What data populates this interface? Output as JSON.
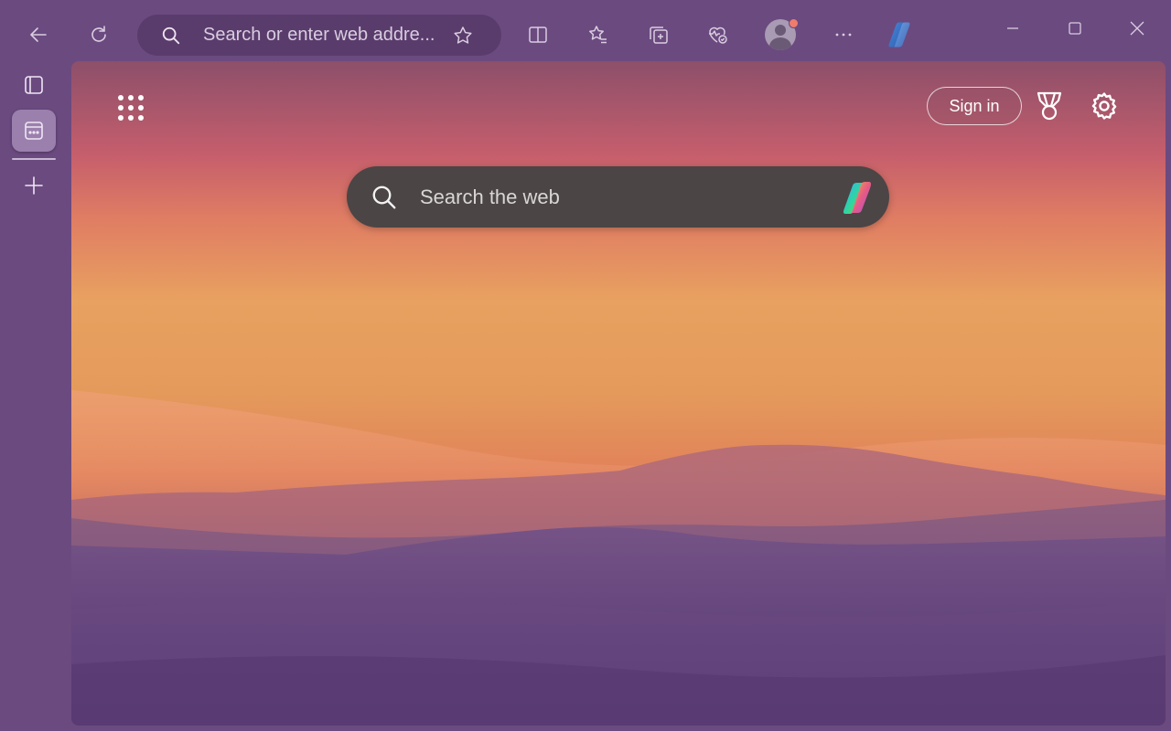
{
  "toolbar": {
    "address_placeholder": "Search or enter web addre..."
  },
  "newtab": {
    "sign_in_label": "Sign in",
    "search_placeholder": "Search the web"
  },
  "colors": {
    "frame": "#6b4a80",
    "address_bar": "#5a3c6c",
    "search_box": "#4b4545",
    "notification_dot": "#f07c6c"
  },
  "icons": {
    "toolbar": [
      "back-arrow-icon",
      "refresh-icon",
      "search-icon",
      "star-icon",
      "split-screen-icon",
      "favorites-icon",
      "collections-icon",
      "browser-essentials-icon",
      "profile-icon",
      "more-icon",
      "copilot-icon",
      "minimize-icon",
      "maximize-icon",
      "close-icon"
    ],
    "rail": [
      "tab-actions-icon",
      "workspaces-icon",
      "add-icon"
    ],
    "newtab": [
      "apps-grid-icon",
      "trophy-icon",
      "settings-gear-icon",
      "search-icon",
      "copilot-icon"
    ]
  }
}
